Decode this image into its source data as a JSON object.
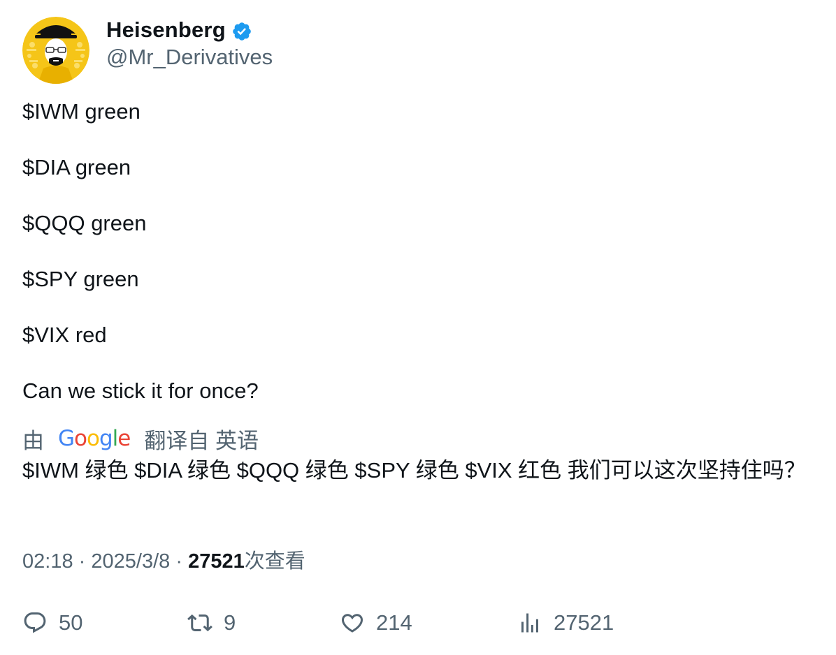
{
  "author": {
    "display_name": "Heisenberg",
    "handle": "@Mr_Derivatives",
    "verified": true,
    "avatar_icon": "heisenberg-avatar",
    "verified_color": "#1d9bf0"
  },
  "tweet": {
    "lines": [
      "$IWM green",
      "$DIA green",
      "$QQQ green",
      "$SPY green",
      "$VIX red",
      "Can we stick it for once?"
    ]
  },
  "translation": {
    "prefix": "由",
    "provider_logo": "Google",
    "suffix": "翻译自 英语",
    "text": "$IWM 绿色 $DIA 绿色 $QQQ 绿色 $SPY 绿色 $VIX 红色 我们可以这次坚持住吗？"
  },
  "meta": {
    "time": "02:18",
    "separator": "·",
    "date": "2025/3/8",
    "views_count": "27521",
    "views_label": "次查看"
  },
  "actions": {
    "reply_count": "50",
    "retweet_count": "9",
    "like_count": "214",
    "views_count": "27521",
    "icons": [
      "reply-icon",
      "retweet-icon",
      "like-icon",
      "views-icon"
    ]
  },
  "colors": {
    "text_primary": "#0f1419",
    "text_secondary": "#536471",
    "verified_blue": "#1d9bf0",
    "avatar_yellow": "#f5c518"
  }
}
